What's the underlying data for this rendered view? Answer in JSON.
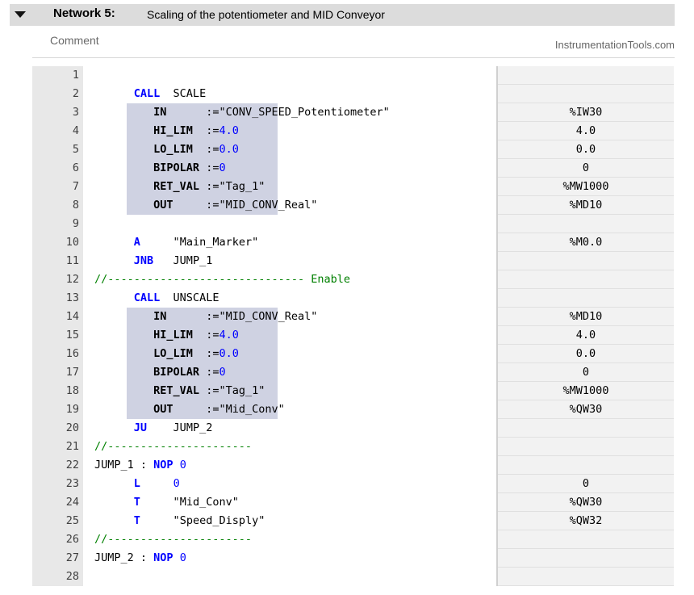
{
  "network": {
    "label": "Network 5:",
    "title": "Scaling of the potentiometer and MID Conveyor"
  },
  "comment": {
    "label": "Comment"
  },
  "watermark": "InstrumentationTools.com",
  "lines": [
    {
      "n": "1",
      "code": "",
      "addr": ""
    },
    {
      "n": "2",
      "code": "      CALL  SCALE",
      "addr": ""
    },
    {
      "n": "3",
      "code": "         IN      :=\"CONV_SPEED_Potentiometer\"",
      "addr": "%IW30"
    },
    {
      "n": "4",
      "code": "         HI_LIM  :=4.0",
      "addr": "4.0"
    },
    {
      "n": "5",
      "code": "         LO_LIM  :=0.0",
      "addr": "0.0"
    },
    {
      "n": "6",
      "code": "         BIPOLAR :=0",
      "addr": "0"
    },
    {
      "n": "7",
      "code": "         RET_VAL :=\"Tag_1\"",
      "addr": "%MW1000"
    },
    {
      "n": "8",
      "code": "         OUT     :=\"MID_CONV_Real\"",
      "addr": "%MD10"
    },
    {
      "n": "9",
      "code": "",
      "addr": ""
    },
    {
      "n": "10",
      "code": "      A     \"Main_Marker\"",
      "addr": "%M0.0"
    },
    {
      "n": "11",
      "code": "      JNB   JUMP_1",
      "addr": ""
    },
    {
      "n": "12",
      "code": "//------------------------------ Enable",
      "addr": ""
    },
    {
      "n": "13",
      "code": "      CALL  UNSCALE",
      "addr": ""
    },
    {
      "n": "14",
      "code": "         IN      :=\"MID_CONV_Real\"",
      "addr": "%MD10"
    },
    {
      "n": "15",
      "code": "         HI_LIM  :=4.0",
      "addr": "4.0"
    },
    {
      "n": "16",
      "code": "         LO_LIM  :=0.0",
      "addr": "0.0"
    },
    {
      "n": "17",
      "code": "         BIPOLAR :=0",
      "addr": "0"
    },
    {
      "n": "18",
      "code": "         RET_VAL :=\"Tag_1\"",
      "addr": "%MW1000"
    },
    {
      "n": "19",
      "code": "         OUT     :=\"Mid_Conv\"",
      "addr": "%QW30"
    },
    {
      "n": "20",
      "code": "      JU    JUMP_2",
      "addr": ""
    },
    {
      "n": "21",
      "code": "//----------------------",
      "addr": ""
    },
    {
      "n": "22",
      "code": "JUMP_1 : NOP 0",
      "addr": ""
    },
    {
      "n": "23",
      "code": "      L     0",
      "addr": "0"
    },
    {
      "n": "24",
      "code": "      T     \"Mid_Conv\"",
      "addr": "%QW30"
    },
    {
      "n": "25",
      "code": "      T     \"Speed_Disply\"",
      "addr": "%QW32"
    },
    {
      "n": "26",
      "code": "//----------------------",
      "addr": ""
    },
    {
      "n": "27",
      "code": "JUMP_2 : NOP 0",
      "addr": ""
    },
    {
      "n": "28",
      "code": "",
      "addr": ""
    }
  ]
}
